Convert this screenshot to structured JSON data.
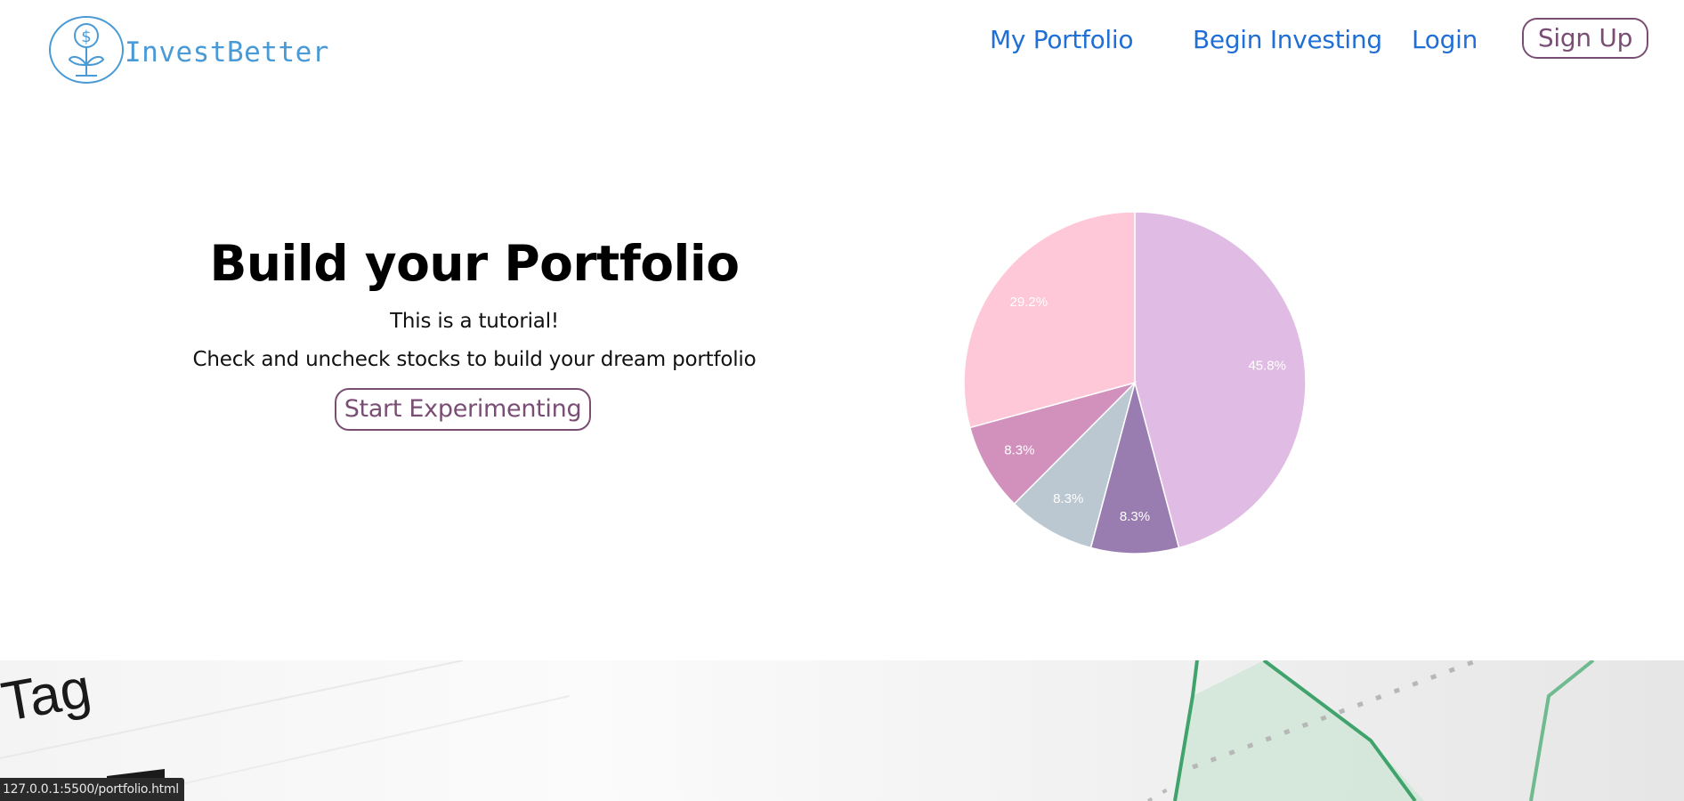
{
  "header": {
    "brand": "InvestBetter",
    "logo_icon": "dollar-seedling-icon",
    "nav": {
      "portfolio": "My Portfolio",
      "begin": "Begin Investing",
      "login": "Login",
      "signup": "Sign Up"
    }
  },
  "hero": {
    "title": "Build your Portfolio",
    "subtitle": "This is a tutorial!",
    "description": "Check and uncheck stocks to build your dream portfolio",
    "cta": "Start Experimenting"
  },
  "chart_data": {
    "type": "pie",
    "values": [
      45.8,
      8.3,
      8.3,
      8.3,
      29.2
    ],
    "labels": [
      "45.8%",
      "8.3%",
      "8.3%",
      "8.3%",
      "29.2%"
    ],
    "colors": [
      "#e0bce4",
      "#9a7db0",
      "#bcc8d1",
      "#d291bc",
      "#fec8d8"
    ],
    "start_angle": "12 o'clock",
    "direction": "clockwise"
  },
  "background": {
    "word": "Tag"
  },
  "status_bar": {
    "url": "127.0.0.1:5500/portfolio.html"
  },
  "colors": {
    "brand": "#4a9ad6",
    "nav_link": "#1f6fd6",
    "button_border": "#7a4e74"
  }
}
